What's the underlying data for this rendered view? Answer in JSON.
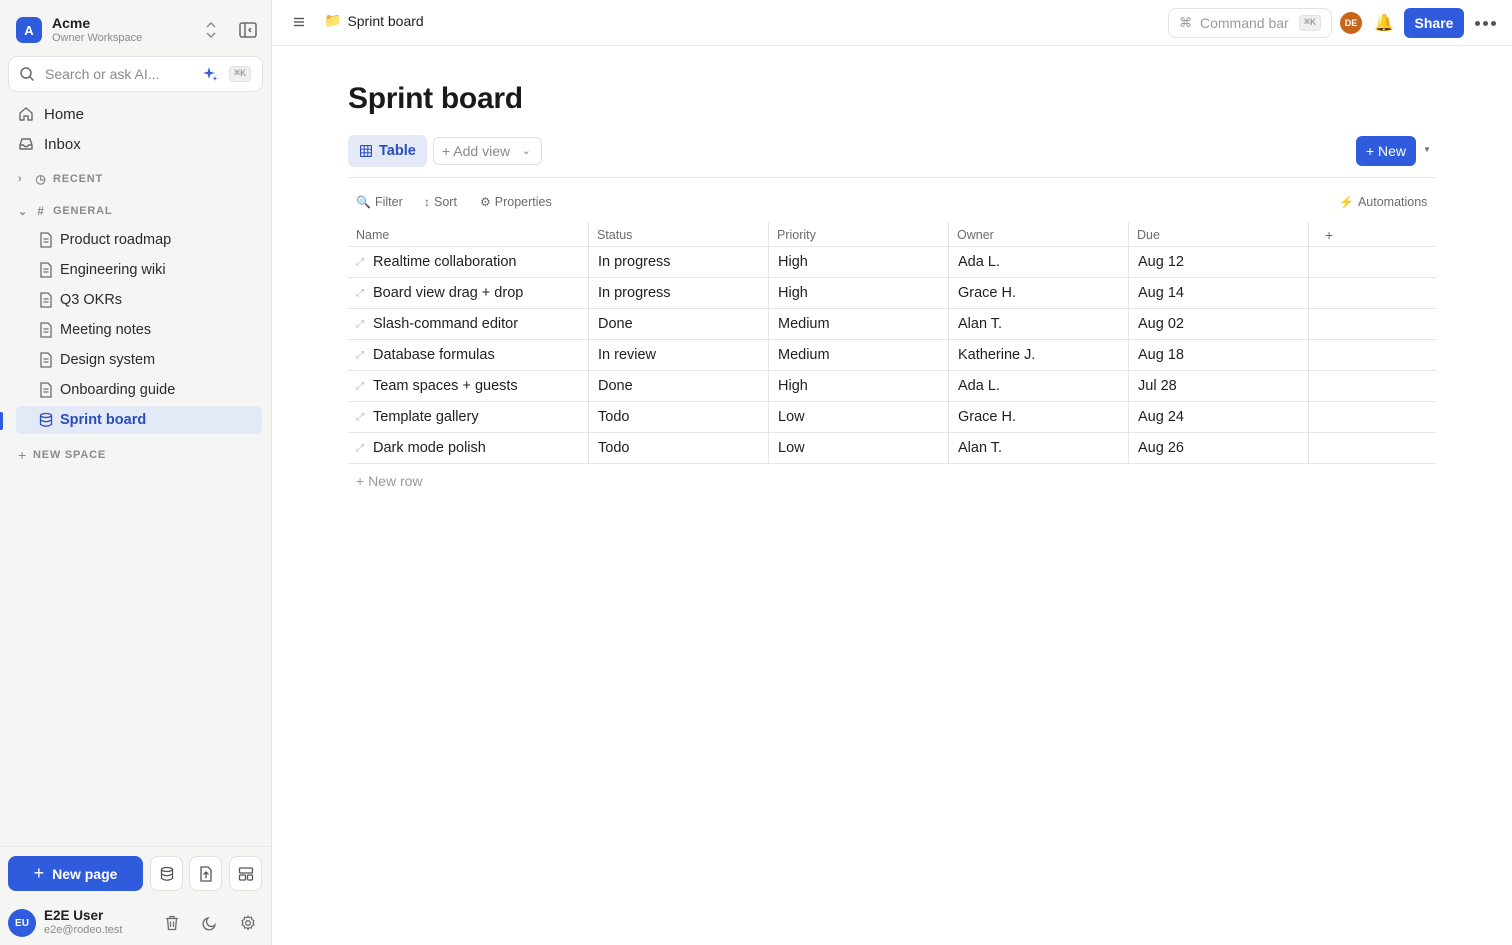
{
  "workspace": {
    "avatar_letter": "A",
    "name": "Acme",
    "subtitle": "Owner Workspace"
  },
  "search": {
    "placeholder": "Search or ask AI...",
    "shortcut": "⌘K"
  },
  "nav": [
    {
      "label": "Home",
      "icon": "home-icon"
    },
    {
      "label": "Inbox",
      "icon": "inbox-icon"
    }
  ],
  "sections": {
    "recent": "RECENT",
    "general": "GENERAL",
    "new_space": "NEW SPACE"
  },
  "pages": [
    {
      "label": "Product roadmap",
      "icon": "page-icon"
    },
    {
      "label": "Engineering wiki",
      "icon": "page-icon"
    },
    {
      "label": "Q3 OKRs",
      "icon": "page-icon"
    },
    {
      "label": "Meeting notes",
      "icon": "page-icon"
    },
    {
      "label": "Design system",
      "icon": "page-icon"
    },
    {
      "label": "Onboarding guide",
      "icon": "page-icon"
    },
    {
      "label": "Sprint board",
      "icon": "database-icon",
      "active": true
    }
  ],
  "sidebar_footer": {
    "new_page_label": "New page",
    "user": {
      "initials": "EU",
      "name": "E2E User",
      "email": "e2e@rodeo.test"
    }
  },
  "topbar": {
    "breadcrumb_emoji": "📁",
    "breadcrumb_title": "Sprint board",
    "command_bar_label": "Command bar",
    "command_bar_shortcut": "⌘K",
    "collaborator_initials": "DE",
    "share_label": "Share"
  },
  "page": {
    "title": "Sprint board",
    "view_tab": "Table",
    "add_view_label": "+ Add view",
    "new_label": "+ New",
    "toolbar": {
      "filter": "Filter",
      "sort": "Sort",
      "properties": "Properties",
      "automations": "Automations"
    },
    "columns": [
      "Name",
      "Status",
      "Priority",
      "Owner",
      "Due"
    ],
    "add_column_label": "+",
    "rows": [
      {
        "name": "Realtime collaboration",
        "status": "In progress",
        "priority": "High",
        "owner": "Ada L.",
        "due": "Aug 12"
      },
      {
        "name": "Board view drag + drop",
        "status": "In progress",
        "priority": "High",
        "owner": "Grace H.",
        "due": "Aug 14"
      },
      {
        "name": "Slash-command editor",
        "status": "Done",
        "priority": "Medium",
        "owner": "Alan T.",
        "due": "Aug 02"
      },
      {
        "name": "Database formulas",
        "status": "In review",
        "priority": "Medium",
        "owner": "Katherine J.",
        "due": "Aug 18"
      },
      {
        "name": "Team spaces + guests",
        "status": "Done",
        "priority": "High",
        "owner": "Ada L.",
        "due": "Jul 28"
      },
      {
        "name": "Template gallery",
        "status": "Todo",
        "priority": "Low",
        "owner": "Grace H.",
        "due": "Aug 24"
      },
      {
        "name": "Dark mode polish",
        "status": "Todo",
        "priority": "Low",
        "owner": "Alan T.",
        "due": "Aug 26"
      }
    ],
    "new_row_label": "+ New row"
  },
  "colors": {
    "accent": "#2f5cdd",
    "sidebar_bg": "#f5f5f4",
    "active_item_bg": "#e4e9f8",
    "collaborator_avatar": "#c8651b"
  }
}
